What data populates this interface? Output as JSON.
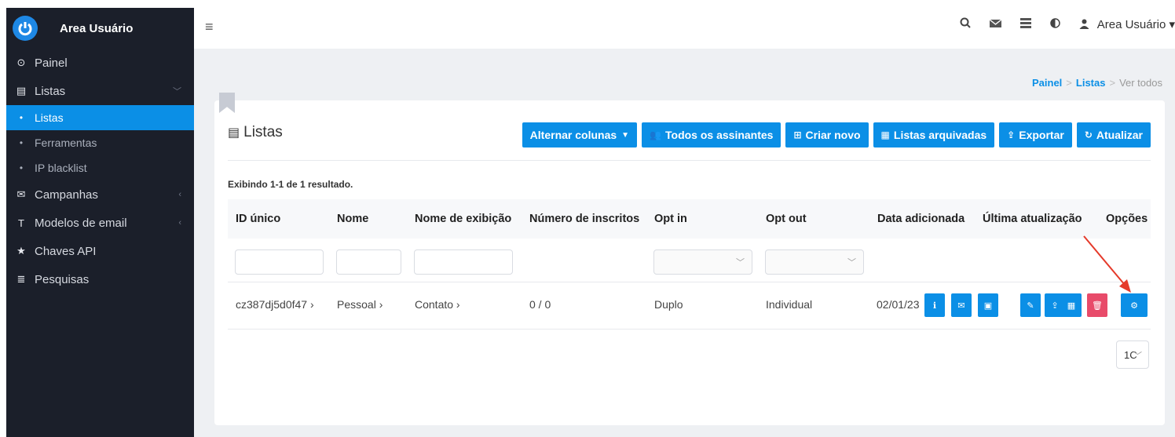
{
  "sidebar": {
    "brand": "Area Usuário",
    "items": [
      {
        "icon": "clock-icon",
        "glyph": "⊙",
        "label": "Painel"
      },
      {
        "icon": "list-icon",
        "glyph": "▤",
        "label": "Listas",
        "chevron": "﹀"
      },
      {
        "icon": "envelope-icon",
        "glyph": "✉",
        "label": "Campanhas",
        "chevron": "‹"
      },
      {
        "icon": "text-icon",
        "glyph": "T",
        "label": "Modelos de email",
        "chevron": "‹"
      },
      {
        "icon": "star-icon",
        "glyph": "★",
        "label": "Chaves API"
      },
      {
        "icon": "bars-icon",
        "glyph": "≣",
        "label": "Pesquisas"
      }
    ],
    "subitems": [
      {
        "label": "Listas",
        "active": true
      },
      {
        "label": "Ferramentas"
      },
      {
        "label": "IP blacklist"
      }
    ]
  },
  "topbar": {
    "menu_glyph": "≡",
    "user": "Area Usuário",
    "user_caret": "▾",
    "icons": [
      "search-icon",
      "envelope-icon",
      "server-icon",
      "contrast-icon"
    ]
  },
  "breadcrumb": {
    "home": "Painel",
    "section": "Listas",
    "current": "Ver todos",
    "sep": ">"
  },
  "card": {
    "title": "Listas",
    "summary": "Exibindo 1-1 de 1 resultado.",
    "buttons": {
      "toggle_columns": "Alternar colunas",
      "all_subscribers": "Todos os assinantes",
      "create_new": "Criar novo",
      "archived_lists": "Listas arquivadas",
      "export": "Exportar",
      "refresh": "Atualizar"
    }
  },
  "table": {
    "columns": [
      "ID único",
      "Nome",
      "Nome de exibição",
      "Número de inscritos",
      "Opt in",
      "Opt out",
      "Data adicionada",
      "Última atualização",
      "Opções"
    ],
    "rows": [
      {
        "id": "cz387dj5d0f47 ›",
        "name": "Pessoal ›",
        "display": "Contato ›",
        "subscribers": "0 / 0",
        "opt_in": "Duplo",
        "opt_out": "Individual",
        "date_added": "02/01/23"
      }
    ]
  },
  "pager": {
    "value": "1C"
  },
  "colors": {
    "accent": "#0b8fe6",
    "sidebar_bg": "#1b1f2a",
    "danger": "#e84b6a",
    "annotation_arrow": "#e53a2a"
  }
}
